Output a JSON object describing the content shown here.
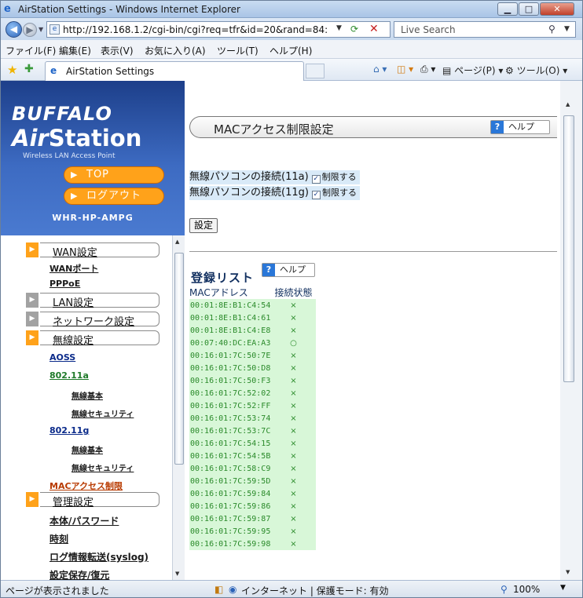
{
  "window": {
    "title": "AirStation Settings - Windows Internet Explorer"
  },
  "toolbar": {
    "url": "http://192.168.1.2/cgi-bin/cgi?req=tfr&id=20&rand=84:",
    "search_placeholder": "Live Search"
  },
  "menu": [
    "ファイル(F)",
    "編集(E)",
    "表示(V)",
    "お気に入り(A)",
    "ツール(T)",
    "ヘルプ(H)"
  ],
  "tab": {
    "label": "AirStation Settings"
  },
  "commands": {
    "page": "ページ(P)",
    "tools": "ツール(O)"
  },
  "logo": {
    "brand": "BUFFALO",
    "air": "Air",
    "station": "Station",
    "subtitle": "Wireless LAN Access Point"
  },
  "nav": {
    "top": "TOP",
    "logout": "ログアウト",
    "model": "WHR-HP-AMPG",
    "items": {
      "wan": "WAN設定",
      "wan_port": "WANポート",
      "pppoe": "PPPoE",
      "lan": "LAN設定",
      "network": "ネットワーク設定",
      "wireless": "無線設定",
      "aoss": "AOSS",
      "a11": "802.11a",
      "a11_basic": "無線基本",
      "a11_sec": "無線セキュリティ",
      "g11": "802.11g",
      "g11_basic": "無線基本",
      "g11_sec": "無線セキュリティ",
      "mac": "MACアクセス制限",
      "admin": "管理設定",
      "password": "本体/パスワード",
      "time": "時刻",
      "syslog": "ログ情報転送(syslog)",
      "save": "設定保存/復元"
    }
  },
  "main": {
    "title": "MACアクセス制限設定",
    "help": "ヘルプ",
    "wl_11a": "無線パソコンの接続(11a)",
    "wl_11g": "無線パソコンの接続(11g)",
    "restrict": "制限する",
    "restrict_11a_checked": true,
    "restrict_11g_checked": true,
    "set_button": "設定",
    "list_title": "登録リスト",
    "list_help": "ヘルプ",
    "col_mac": "MACアドレス",
    "col_state": "接続状態",
    "rows": [
      {
        "mac": "00:01:8E:B1:C4:54",
        "state": "×"
      },
      {
        "mac": "00:01:8E:B1:C4:61",
        "state": "×"
      },
      {
        "mac": "00:01:8E:B1:C4:E8",
        "state": "×"
      },
      {
        "mac": "00:07:40:DC:EA:A3",
        "state": "○"
      },
      {
        "mac": "00:16:01:7C:50:7E",
        "state": "×"
      },
      {
        "mac": "00:16:01:7C:50:D8",
        "state": "×"
      },
      {
        "mac": "00:16:01:7C:50:F3",
        "state": "×"
      },
      {
        "mac": "00:16:01:7C:52:02",
        "state": "×"
      },
      {
        "mac": "00:16:01:7C:52:FF",
        "state": "×"
      },
      {
        "mac": "00:16:01:7C:53:74",
        "state": "×"
      },
      {
        "mac": "00:16:01:7C:53:7C",
        "state": "×"
      },
      {
        "mac": "00:16:01:7C:54:15",
        "state": "×"
      },
      {
        "mac": "00:16:01:7C:54:5B",
        "state": "×"
      },
      {
        "mac": "00:16:01:7C:58:C9",
        "state": "×"
      },
      {
        "mac": "00:16:01:7C:59:5D",
        "state": "×"
      },
      {
        "mac": "00:16:01:7C:59:84",
        "state": "×"
      },
      {
        "mac": "00:16:01:7C:59:86",
        "state": "×"
      },
      {
        "mac": "00:16:01:7C:59:87",
        "state": "×"
      },
      {
        "mac": "00:16:01:7C:59:95",
        "state": "×"
      },
      {
        "mac": "00:16:01:7C:59:98",
        "state": "×"
      }
    ]
  },
  "status": {
    "left": "ページが表示されました",
    "zone": "インターネット | 保護モード: 有効",
    "zoom": "100%"
  },
  "colors": {
    "brand_blue": "#2b55a8",
    "nav_orange": "#ffa21a",
    "list_green": "#d8f7d8"
  },
  "icons": [
    "ie-icon",
    "back-icon",
    "forward-icon",
    "refresh-icon",
    "stop-icon",
    "search-icon",
    "favorites-star-icon",
    "add-favorites-icon",
    "home-icon",
    "feeds-icon",
    "print-icon",
    "page-icon",
    "tools-icon",
    "help-icon",
    "globe-icon"
  ]
}
